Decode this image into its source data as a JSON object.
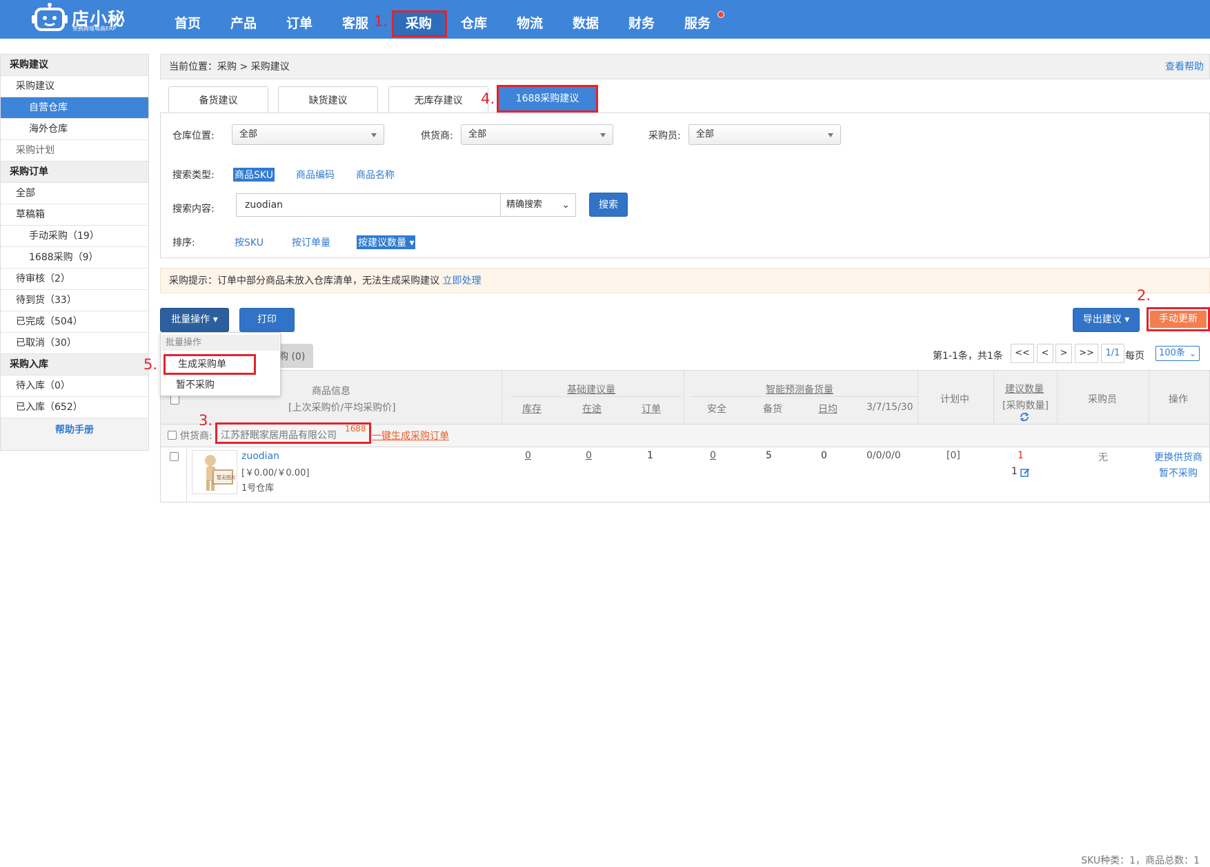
{
  "app": {
    "logo_name": "店小秘",
    "logo_slogan": "免费跨境电商ERP"
  },
  "nav": {
    "items": [
      "首页",
      "产品",
      "订单",
      "客服",
      "采购",
      "仓库",
      "物流",
      "数据",
      "财务",
      "服务"
    ],
    "active": "采购",
    "has_notification_dot": true
  },
  "annotations": {
    "step1": "1.",
    "step2": "2.",
    "step3": "3.",
    "step4": "4.",
    "step5": "5."
  },
  "sidebar": {
    "sec1_title": "采购建议",
    "sec1_item": "采购建议",
    "sec1_sub1": "自营仓库",
    "sec1_sub2": "海外仓库",
    "sec1_plan": "采购计划",
    "sec2_title": "采购订单",
    "all": "全部",
    "draft": "草稿箱",
    "draft_manual": "手动采购（19）",
    "draft_1688": "1688采购（9）",
    "pending_review": "待审核（2）",
    "pending_arrival": "待到货（33）",
    "completed": "已完成（504）",
    "cancelled": "已取消（30）",
    "sec3_title": "采购入库",
    "pending_inbound": "待入库（0）",
    "inbound": "已入库（652）",
    "help": "帮助手册"
  },
  "breadcrumb": {
    "text": "当前位置：采购 > 采购建议",
    "help_link": "查看帮助"
  },
  "tabs": {
    "t1": "备货建议",
    "t2": "缺货建议",
    "t3": "无库存建议",
    "t4": "1688采购建议",
    "active": "1688采购建议"
  },
  "filters": {
    "warehouse_label": "仓库位置:",
    "warehouse_value": "全部",
    "supplier_label": "供货商:",
    "supplier_value": "全部",
    "buyer_label": "采购员:",
    "buyer_value": "全部",
    "search_type_label": "搜索类型:",
    "search_type_sku": "商品SKU",
    "search_type_code": "商品编码",
    "search_type_name": "商品名称",
    "search_type_selected": "商品SKU",
    "search_content_label": "搜索内容:",
    "search_value": "zuodian",
    "match_mode": "精确搜索",
    "search_button": "搜索",
    "sort_label": "排序:",
    "sort_sku": "按SKU",
    "sort_order_qty": "按订单量",
    "sort_suggest_qty": "按建议数量 ▾",
    "sort_selected": "按建议数量"
  },
  "tip": {
    "text": "采购提示：订单中部分商品未放入仓库清单，无法生成采购建议",
    "action": "立即处理"
  },
  "toolbar": {
    "batch": "批量操作 ▾",
    "print": "打印",
    "export": "导出建议 ▾",
    "manual_update": "手动更新"
  },
  "batch_menu": {
    "header": "批量操作",
    "item_generate": "生成采购单",
    "item_skip": "暂不采购"
  },
  "subtab": {
    "label": "购 (0)"
  },
  "pagination": {
    "info": "第1-1条，共1条",
    "first": "<<",
    "prev": "<",
    "next": ">",
    "last": ">>",
    "page": "1/1",
    "per_page_label": "每页",
    "per_page_value": "100条"
  },
  "table": {
    "col_product": "商品信息",
    "col_product_sub": "[上次采购价/平均采购价]",
    "group_basic": "基础建议量",
    "col_stock": "库存",
    "col_in_transit": "在途",
    "col_order": "订单",
    "group_forecast": "智能预测备货量",
    "col_safe": "安全",
    "col_stockup": "备货",
    "col_daily": "日均",
    "col_days": "3/7/15/30",
    "col_planned": "计划中",
    "col_suggest": "建议数量",
    "col_suggest_sub": "[采购数量]",
    "col_buyer": "采购员",
    "col_action": "操作"
  },
  "supplier_group": {
    "label": "供货商:",
    "name": "江苏舒眠家居用品有限公司",
    "badge": "1688",
    "generate_link": "一键生成采购订单",
    "summary": "SKU种类：1，商品总数：1"
  },
  "rows": [
    {
      "sku": "zuodian",
      "price": "[￥0.00/￥0.00]",
      "warehouse": "1号仓库",
      "thumb_text": "暂无图片",
      "stock": "0",
      "in_transit": "0",
      "order": "1",
      "safe": "0",
      "stockup": "5",
      "daily": "0",
      "days": "0/0/0/0",
      "planned": "[0]",
      "suggest": "1",
      "purchase_qty": "1",
      "buyer": "无",
      "action_change": "更换供货商",
      "action_skip": "暂不采购"
    }
  ],
  "colors": {
    "nav_bg": "#3e84d8",
    "accent_blue": "#2f7ad1",
    "highlight_red": "#e4222c",
    "manual_update_orange": "#f47e4d",
    "supplier_orange": "#f05a24"
  }
}
